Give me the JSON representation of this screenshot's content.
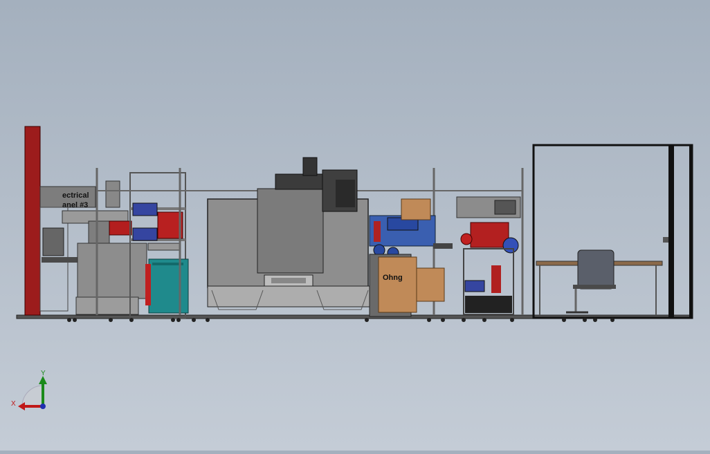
{
  "scene": {
    "panel_label_line1": "ectrical",
    "panel_label_line2": "anel #3",
    "box_label": "Ohng"
  },
  "triad": {
    "x_label": "X",
    "y_label": "Y"
  },
  "colors": {
    "background_top": "#a4b0be",
    "background_bottom": "#c4ccd6",
    "column_red": "#9c1c1c",
    "machine_gray": "#8c8c8c",
    "cabinet_teal": "#1f8a8c",
    "cardboard": "#c08a58",
    "accent_blue": "#3050b0"
  }
}
